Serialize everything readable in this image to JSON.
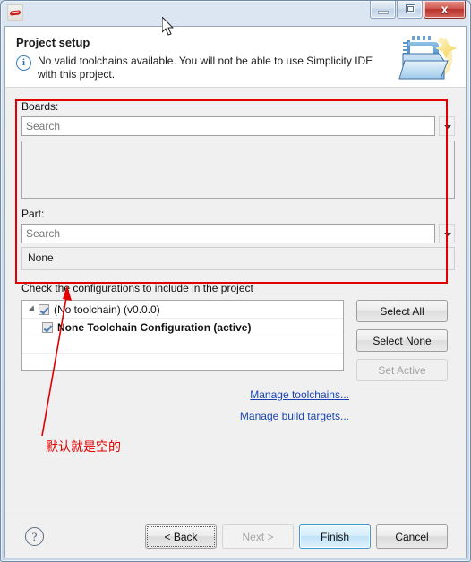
{
  "window": {
    "app_icon": "simplicity-studio-icon",
    "controls": {
      "minimize": "minimize-icon",
      "restore": "restore-icon",
      "close_label": "x"
    }
  },
  "header": {
    "title": "Project setup",
    "info_icon": "info-icon",
    "info_glyph": "i",
    "message": "No valid toolchains available. You will not be able to use Simplicity IDE with this project.",
    "banner_icon": "new-project-wizard-icon"
  },
  "boards": {
    "label": "Boards:",
    "search_placeholder": "Search",
    "search_value": "",
    "dropdown_icon": "chevron-down-icon",
    "list_items": []
  },
  "part": {
    "label": "Part:",
    "search_placeholder": "Search",
    "search_value": "",
    "dropdown_icon": "chevron-down-icon",
    "selected": "None"
  },
  "configurations": {
    "caption": "Check the configurations to include in the project",
    "rows": [
      {
        "label": "(No toolchain) (v0.0.0)",
        "checked": true,
        "expanded": true,
        "child": false
      },
      {
        "label": "None Toolchain Configuration (active)",
        "checked": true,
        "child": true
      }
    ],
    "buttons": [
      {
        "name": "select-all-button",
        "pre": "S",
        "mnemonic": "",
        "label": "Select All",
        "disabled": false
      },
      {
        "name": "select-none-button",
        "label": "Select None",
        "disabled": false
      },
      {
        "name": "set-active-button",
        "label": "Set Active",
        "disabled": true
      }
    ],
    "links": [
      {
        "name": "manage-toolchains-link",
        "label": "Manage toolchains..."
      },
      {
        "name": "manage-build-targets-link",
        "label": "Manage build targets..."
      }
    ]
  },
  "footer": {
    "help_glyph": "?",
    "buttons": [
      {
        "name": "back-button",
        "label": "< Back",
        "state": "focused"
      },
      {
        "name": "next-button",
        "label": "Next >",
        "state": "disabled"
      },
      {
        "name": "finish-button",
        "label": "Finish",
        "state": "default"
      },
      {
        "name": "cancel-button",
        "label": "Cancel",
        "state": "normal"
      }
    ]
  },
  "annotations": {
    "note_text": "默认就是空的",
    "accent_color": "#e00000"
  }
}
